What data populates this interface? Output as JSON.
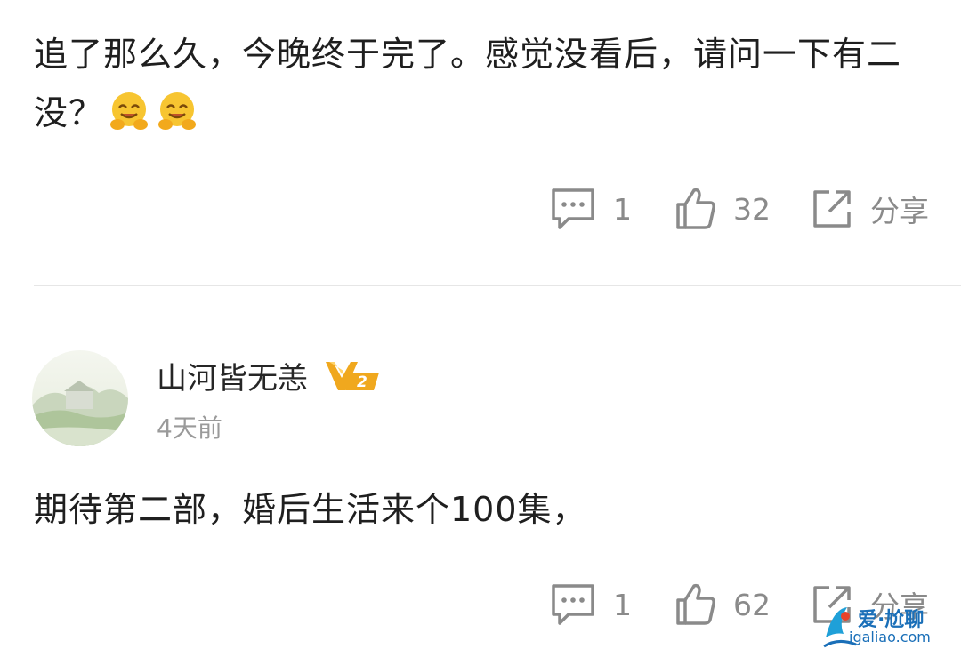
{
  "comment1": {
    "text": "追了那么久，今晚终于完了。感觉没看后，请问一下有二没？",
    "emoji": "hug-emoji",
    "reply_count": "1",
    "like_count": "32",
    "share_label": "分享"
  },
  "comment2": {
    "username": "山河皆无恙",
    "vip_level": "V2",
    "time": "4天前",
    "text": "期待第二部，婚后生活来个100集，",
    "reply_count": "1",
    "like_count": "62",
    "share_label": "分享"
  },
  "watermark": {
    "line1": "爱·尬聊",
    "line2": "igaliao.com"
  },
  "colors": {
    "icon_gray": "#8a8a8a",
    "vip_gold": "#f0a81e",
    "watermark_blue": "#1a6fb8"
  }
}
